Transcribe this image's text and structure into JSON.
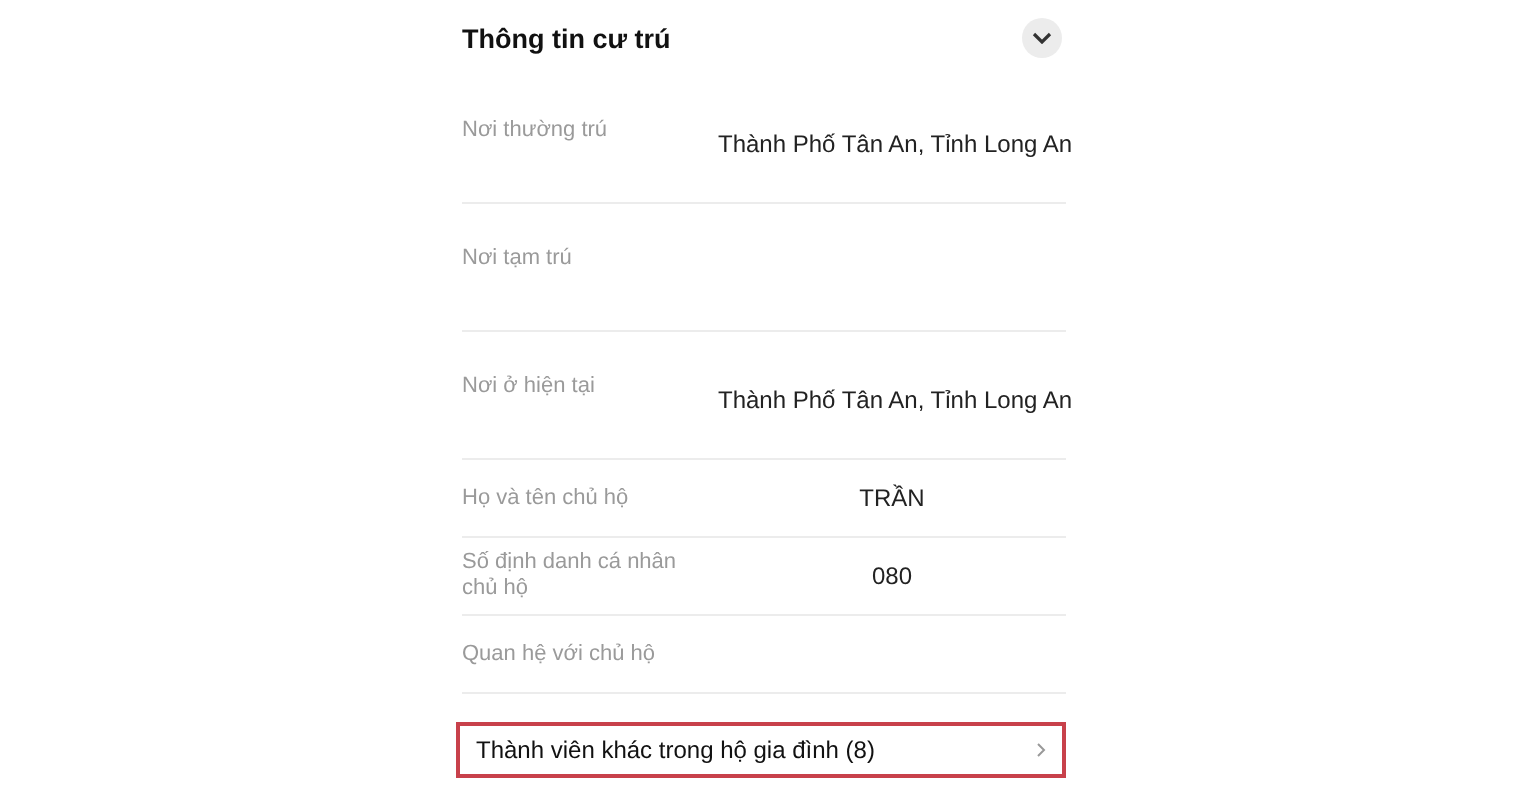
{
  "section": {
    "title": "Thông tin cư trú",
    "expanded": true
  },
  "rows": [
    {
      "kind": "address",
      "label": "Nơi thường trú",
      "value": "Thành Phố Tân An, Tỉnh Long An"
    },
    {
      "kind": "address",
      "label": "Nơi tạm trú"
    },
    {
      "kind": "address",
      "label": "Nơi ở hiện tại",
      "value": "Thành Phố Tân An, Tỉnh Long An"
    },
    {
      "kind": "detail",
      "label": "Họ và tên chủ hộ",
      "value": "TRẦN"
    },
    {
      "kind": "detail",
      "label": "Số định danh cá nhân chủ hộ",
      "value": "080"
    },
    {
      "kind": "detail",
      "label": "Quan hệ với chủ hộ"
    }
  ],
  "family_link": {
    "label": "Thành viên khác trong hộ gia đình (8)",
    "highlighted": true
  }
}
